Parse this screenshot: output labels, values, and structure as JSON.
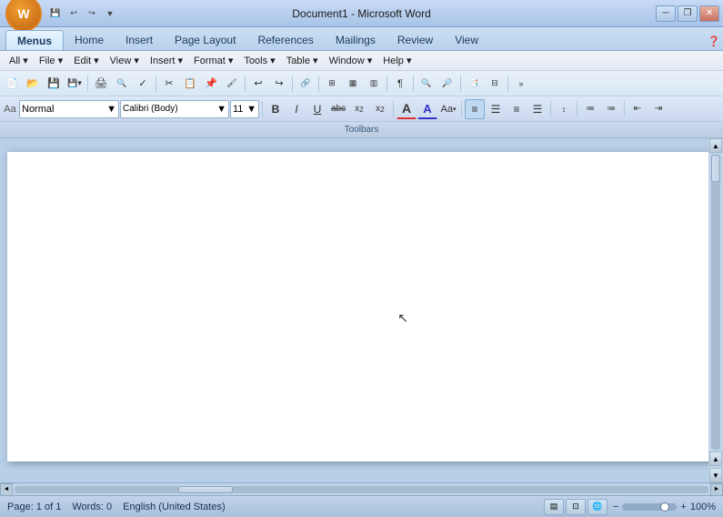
{
  "titleBar": {
    "title": "Document1 - Microsoft Word",
    "minimizeLabel": "─",
    "restoreLabel": "❐",
    "closeLabel": "✕"
  },
  "quickAccess": {
    "save": "💾",
    "undo": "↩",
    "redo": "↪",
    "dropdown": "▼"
  },
  "ribbon": {
    "tabs": [
      {
        "label": "Menus",
        "active": true
      },
      {
        "label": "Home"
      },
      {
        "label": "Insert"
      },
      {
        "label": "Page Layout"
      },
      {
        "label": "References"
      },
      {
        "label": "Mailings"
      },
      {
        "label": "Review"
      },
      {
        "label": "View"
      }
    ]
  },
  "classicMenu": {
    "items": [
      {
        "label": "All ▾"
      },
      {
        "label": "File ▾"
      },
      {
        "label": "Edit ▾"
      },
      {
        "label": "View ▾"
      },
      {
        "label": "Insert ▾"
      },
      {
        "label": "Format ▾"
      },
      {
        "label": "Tools ▾"
      },
      {
        "label": "Table ▾"
      },
      {
        "label": "Window ▾"
      },
      {
        "label": "Help ▾"
      }
    ]
  },
  "formatToolbar": {
    "style": "Normal",
    "styleDropdown": "▼",
    "font": "Calibri (Body)",
    "fontDropdown": "▼",
    "size": "11",
    "sizeDropdown": "▼",
    "bold": "B",
    "italic": "I",
    "underline": "U",
    "strikethrough": "ab̶c",
    "subscript": "x₂",
    "superscript": "x²",
    "bigA": "A",
    "bigAStyle": "A",
    "charStyle": "Aa"
  },
  "toolbarsLabel": "Toolbars",
  "statusBar": {
    "page": "Page: 1 of 1",
    "words": "Words: 0",
    "language": "English (United States)",
    "zoom": "100%"
  }
}
